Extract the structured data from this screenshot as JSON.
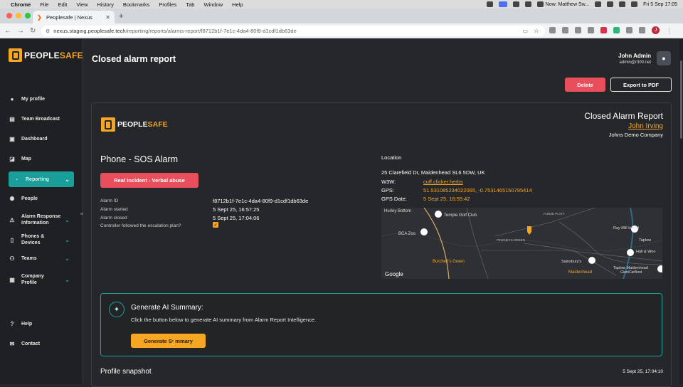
{
  "menubar": {
    "app": "Chrome",
    "items": [
      "File",
      "Edit",
      "View",
      "History",
      "Bookmarks",
      "Profiles",
      "Tab",
      "Window",
      "Help"
    ],
    "now_playing": "Now: Matthew Sw...",
    "datetime": "Fri 5 Sep  17:05"
  },
  "browser": {
    "tab_title": "Peoplesafe | Nexus",
    "url_host": "nexus.staging.peoplesafe.tech",
    "url_path": "/reporting/reports/alarms-report/f8712b1f-7e1c-4da4-80f9-d1cdf1db63de",
    "profile_initial": "J"
  },
  "sidebar": {
    "brand_left": "PEOPLE",
    "brand_right": "SAFE",
    "items": [
      {
        "label": "My profile",
        "icon": "user-icon"
      },
      {
        "label": "Team Broadcast",
        "icon": "broadcast-icon"
      },
      {
        "label": "Dashboard",
        "icon": "dashboard-icon"
      },
      {
        "label": "Map",
        "icon": "map-icon"
      },
      {
        "label": "Reporting",
        "icon": "reporting-icon"
      },
      {
        "label": "People",
        "icon": "people-icon"
      },
      {
        "label": "Alarm Response Information",
        "icon": "alarm-icon"
      },
      {
        "label": "Phones & Devices",
        "icon": "phone-icon"
      },
      {
        "label": "Teams",
        "icon": "teams-icon"
      },
      {
        "label": "Company Profile",
        "icon": "company-icon"
      },
      {
        "label": "Help",
        "icon": "help-icon"
      },
      {
        "label": "Contact",
        "icon": "mail-icon"
      }
    ]
  },
  "header": {
    "title": "Closed alarm report",
    "user_name": "John Admin",
    "user_email": "admin@r300.net",
    "delete_label": "Delete",
    "export_label": "Export to PDF"
  },
  "report": {
    "heading": "Closed Alarm Report",
    "person": "John Irving",
    "company": "Johns Demo Company",
    "alarm_type": "Phone - SOS Alarm",
    "incident_badge": "Real Incident - Verbal abuse",
    "fields": [
      {
        "label": "Alarm ID",
        "value": "f8712b1f-7e1c-4da4-80f9-d1cdf1db63de"
      },
      {
        "label": "Alarm started",
        "value": "5 Sept 25, 16:57:25"
      },
      {
        "label": "Alarm closed",
        "value": "5 Sept 25, 17:04:06"
      },
      {
        "label": "Controller followed the escalation plan?",
        "value": "✓"
      }
    ],
    "location": {
      "heading": "Location",
      "address": "25 Clarefield Dr, Maidenhead SL6 5DW, UK",
      "w3w_label": "W3W:",
      "w3w_value": "cuff.clicker.herbs",
      "gps_label": "GPS:",
      "gps_value": "51.531085234022065, -0.7531465150795414",
      "gps_date_label": "GPS Date:",
      "gps_date_value": "5 Sept 25, 16:55:42"
    },
    "map_labels": [
      "Hurley Bottom",
      "Temple Golf Club",
      "BCA Zoo",
      "FURZE PLATT",
      "Ray Mill Island",
      "Taplow",
      "PINKNEYS GREEN",
      "Hall & Woo",
      "Burchett's Green",
      "Sainsbury's",
      "Taplow Maidenhead",
      "Maidenhead",
      "GiantCarBoot",
      "Google"
    ],
    "ai": {
      "title": "Generate AI Summary:",
      "description": "Click the button below to generate AI summary from Alarm Report Intelligence.",
      "button": "Generate Summary"
    },
    "snapshot": {
      "title": "Profile snapshot",
      "date": "5 Sept 25, 17:04:10"
    }
  },
  "colors": {
    "accent_orange": "#f5a623",
    "teal": "#1a9e9a",
    "danger": "#e94e5c",
    "background": "#25272b"
  }
}
